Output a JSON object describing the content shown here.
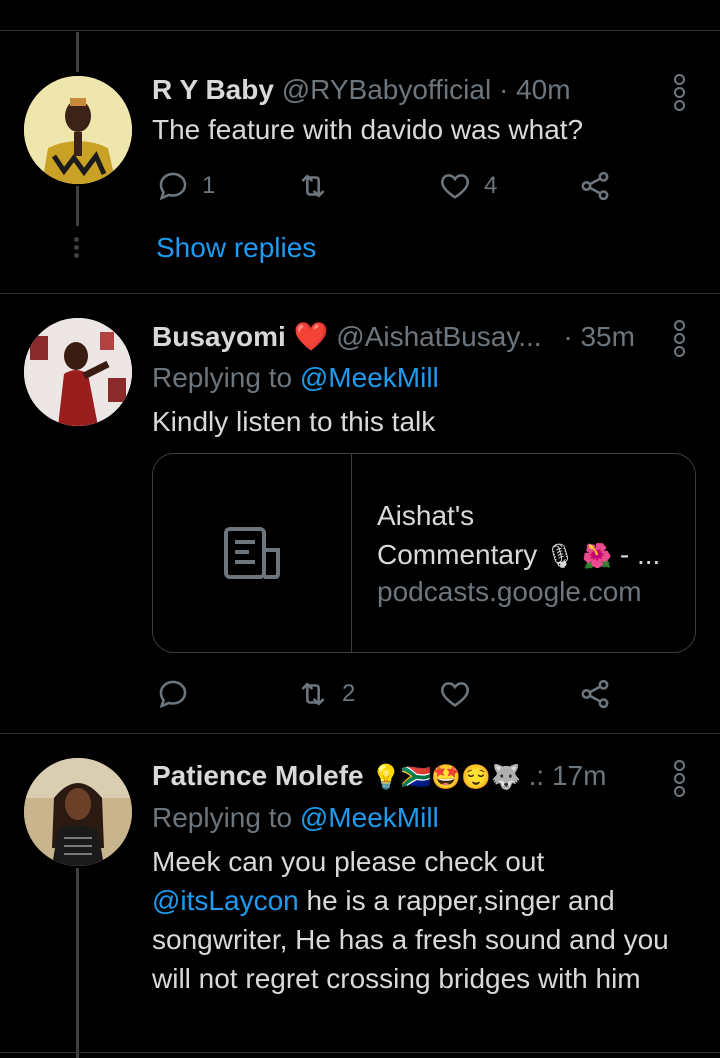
{
  "tweets": [
    {
      "name": "R Y Baby",
      "handle": "@RYBabyofficial",
      "time": "· 40m",
      "text": "The feature with davido was what?",
      "replies": "1",
      "retweets": "",
      "likes": "4",
      "show_replies": "Show replies"
    },
    {
      "name": "Busayomi",
      "name_emoji": "❤️",
      "handle": "@AishatBusay...",
      "time": "· 35m",
      "replying_prefix": "Replying to",
      "replying_to": "@MeekMill",
      "text": "Kindly listen to this talk",
      "card": {
        "title_line1": "Aishat's",
        "title_line2": "Commentary",
        "title_emojis": "🎙 🌺",
        "title_suffix": "- ...",
        "domain": "podcasts.google.com"
      },
      "replies": "",
      "retweets": "2",
      "likes": ""
    },
    {
      "name": "Patience Molefe",
      "name_emojis": "💡🇿🇦🤩😌🐺",
      "handle_trunc": ".:",
      "time": "17m",
      "replying_prefix": "Replying to",
      "replying_to": "@MeekMill",
      "text_line1": "Meek can you please check out",
      "mention": "@itsLaycon",
      "text_rest": " he is a rapper,singer and songwriter, He has a fresh sound and you will not regret crossing bridges with him"
    }
  ],
  "colors": {
    "background": "#000000",
    "text": "#d9d9d9",
    "muted": "#6e767d",
    "accent": "#1d9bf0",
    "divider": "#2f3336"
  },
  "icons": [
    "reply-icon",
    "retweet-icon",
    "like-icon",
    "share-icon",
    "more-icon",
    "article-icon"
  ]
}
